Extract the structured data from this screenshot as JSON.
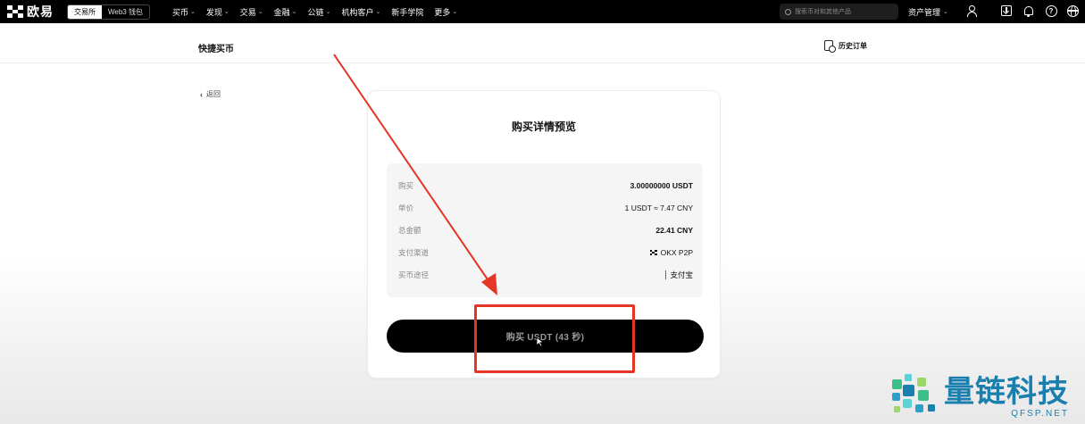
{
  "topbar": {
    "brand": "欧易",
    "mode_tabs": [
      "交易所",
      "Web3 钱包"
    ],
    "nav": [
      {
        "label": "买币",
        "chevron": true
      },
      {
        "label": "发现",
        "chevron": true
      },
      {
        "label": "交易",
        "chevron": true
      },
      {
        "label": "金融",
        "chevron": true
      },
      {
        "label": "公链",
        "chevron": true
      },
      {
        "label": "机构客户",
        "chevron": true
      },
      {
        "label": "新手学院",
        "chevron": false
      },
      {
        "label": "更多",
        "chevron": true
      }
    ],
    "search_placeholder": "搜索币对和其他产品",
    "asset_menu": "资产管理",
    "icons": [
      "user-icon",
      "download-icon",
      "bell-icon",
      "help-icon",
      "globe-icon"
    ]
  },
  "subheader": {
    "title": "快捷买币",
    "history": "历史订单"
  },
  "back_label": "返回",
  "card": {
    "title": "购买详情预览",
    "rows": [
      {
        "key": "购买",
        "value": "3.00000000 USDT",
        "bold": true
      },
      {
        "key": "单价",
        "value": "1 USDT ≈ 7.47 CNY",
        "bold": false
      },
      {
        "key": "总金额",
        "value": "22.41 CNY",
        "bold": true
      },
      {
        "key": "支付渠道",
        "value": "OKX P2P",
        "bold": false
      },
      {
        "key": "买币途径",
        "value": "支付宝",
        "bold": false
      }
    ],
    "button": "购买 USDT (43 秒)"
  },
  "watermark": {
    "cn": "量链科技",
    "en": "QFSP.NET"
  },
  "colors": {
    "annotation_red": "#e53525",
    "watermark_blue": "#1a7fae",
    "alipay_blue": "#1677ff"
  }
}
